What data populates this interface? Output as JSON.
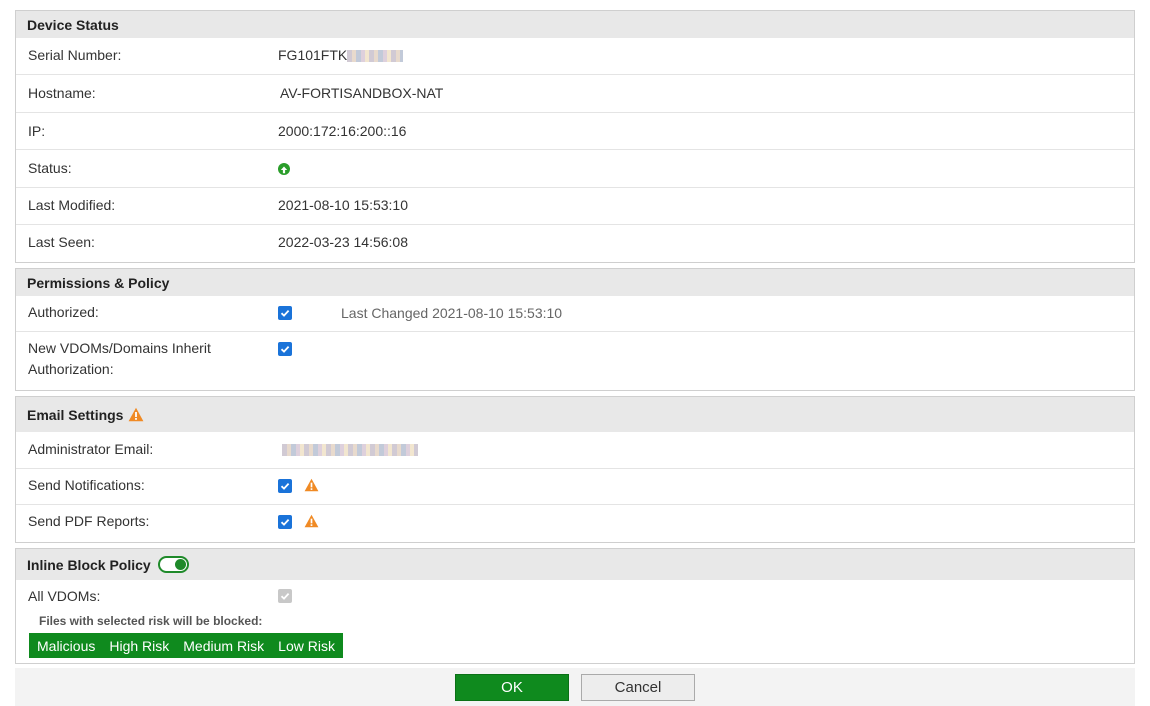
{
  "device_status": {
    "title": "Device Status",
    "serial_label": "Serial Number:",
    "serial_value": "FG101FTK",
    "hostname_label": "Hostname:",
    "hostname_value": "AV-FORTISANDBOX-NAT",
    "ip_label": "IP:",
    "ip_value": "2000:172:16:200::16",
    "status_label": "Status:",
    "status_icon": "arrow-up-circle-icon",
    "status_color": "#2a9d2a",
    "last_modified_label": "Last Modified:",
    "last_modified_value": "2021-08-10 15:53:10",
    "last_seen_label": "Last Seen:",
    "last_seen_value": "2022-03-23 14:56:08"
  },
  "permissions": {
    "title": "Permissions & Policy",
    "authorized_label": "Authorized:",
    "authorized_checked": true,
    "last_changed": "Last Changed 2021-08-10 15:53:10",
    "inherit_label_line1": "New VDOMs/Domains Inherit",
    "inherit_label_line2": "Authorization:",
    "inherit_checked": true
  },
  "email_settings": {
    "title": "Email Settings",
    "admin_email_label": "Administrator Email:",
    "send_notifications_label": "Send Notifications:",
    "send_notifications_checked": true,
    "send_pdf_label": "Send PDF Reports:",
    "send_pdf_checked": true,
    "warning_color": "#f08a24"
  },
  "inline_block": {
    "title": "Inline Block Policy",
    "enabled": true,
    "all_vdoms_label": "All VDOMs:",
    "all_vdoms_checked": true,
    "files_note": "Files with selected risk will be blocked:",
    "risks": [
      "Malicious",
      "High Risk",
      "Medium Risk",
      "Low Risk"
    ],
    "risk_color": "#0f8a1e"
  },
  "footer": {
    "ok_label": "OK",
    "cancel_label": "Cancel"
  }
}
